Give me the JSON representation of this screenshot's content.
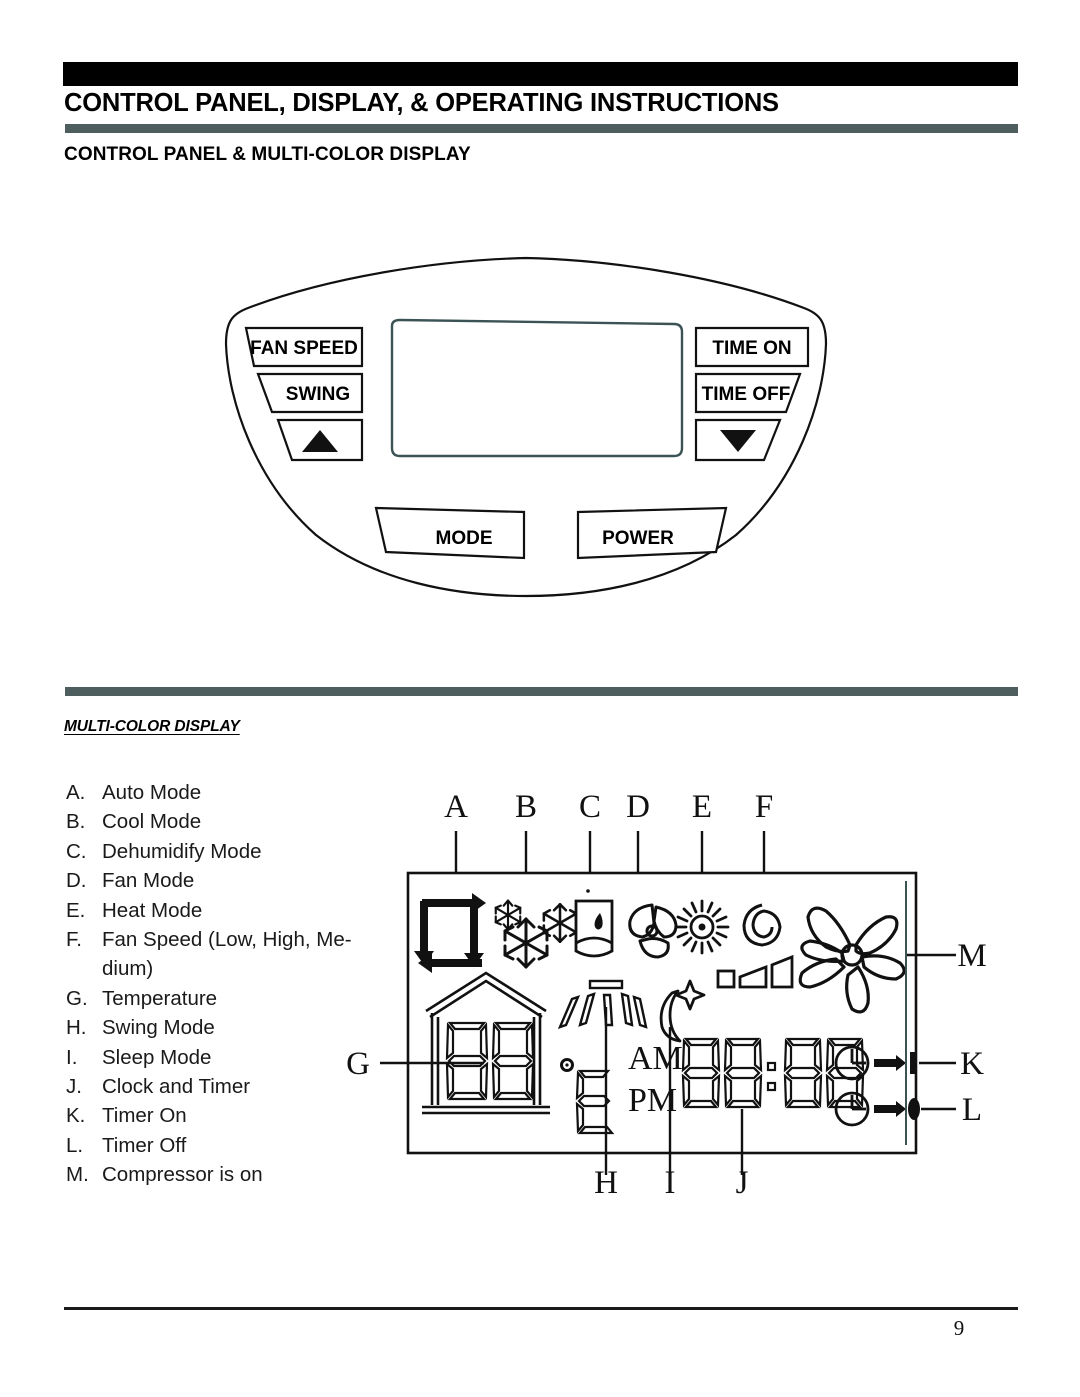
{
  "header": {
    "title": "CONTROL PANEL, DISPLAY, & OPERATING INSTRUCTIONS",
    "section_title": "CONTROL PANEL & MULTI-COLOR DISPLAY",
    "rule_color": "#4e5d5e",
    "bar_color": "#000000"
  },
  "control_panel": {
    "buttons": [
      {
        "label": "FAN SPEED",
        "name": "fan-speed-button"
      },
      {
        "label": "SWING",
        "name": "swing-button"
      },
      {
        "label": "MODE",
        "name": "mode-button"
      },
      {
        "label": "POWER",
        "name": "power-button"
      },
      {
        "label": "TIME ON",
        "name": "time-on-button"
      },
      {
        "label": "TIME OFF",
        "name": "time-off-button"
      }
    ],
    "up_arrow": "▲",
    "down_arrow": "▼"
  },
  "multicolor": {
    "subsection_title": "MULTI-COLOR DISPLAY",
    "legend": [
      {
        "letter": "A.",
        "text": "Auto Mode"
      },
      {
        "letter": "B.",
        "text": "Cool Mode"
      },
      {
        "letter": "C.",
        "text": "Dehumidify Mode"
      },
      {
        "letter": "D.",
        "text": "Fan Mode"
      },
      {
        "letter": "E.",
        "text": "Heat Mode"
      },
      {
        "letter": "F.",
        "text": "Fan Speed (Low, High, Me-"
      },
      {
        "letter": "",
        "text": "dium)"
      },
      {
        "letter": "G.",
        "text": "Temperature"
      },
      {
        "letter": "H.",
        "text": "Swing Mode"
      },
      {
        "letter": "I.",
        "text": "Sleep Mode"
      },
      {
        "letter": "J.",
        "text": "Clock and Timer"
      },
      {
        "letter": "K.",
        "text": "Timer On"
      },
      {
        "letter": "L.",
        "text": "Timer Off"
      },
      {
        "letter": "M.",
        "text": "Compressor is on"
      }
    ],
    "callouts_top": [
      "A",
      "B",
      "C",
      "D",
      "E",
      "F"
    ],
    "callouts_bottom": [
      "H",
      "I",
      "J"
    ],
    "callout_left": "G",
    "callouts_right": [
      "M",
      "K",
      "L"
    ],
    "display_text": {
      "am": "AM",
      "pm": "PM",
      "unit": "E",
      "temp_digits": "88",
      "clock_digits": "88:88"
    },
    "icons": [
      "auto-mode-icon",
      "snowflake-icon",
      "dehumidify-icon",
      "fan-mode-icon",
      "sun-heat-icon",
      "fan-speed-swirl-icon",
      "fan-speed-bars-icon",
      "compressor-fan-icon",
      "house-icon",
      "swing-louver-icon",
      "sleep-moon-icon",
      "timer-on-icon",
      "timer-off-icon"
    ]
  },
  "footer": {
    "page_number": "9"
  }
}
